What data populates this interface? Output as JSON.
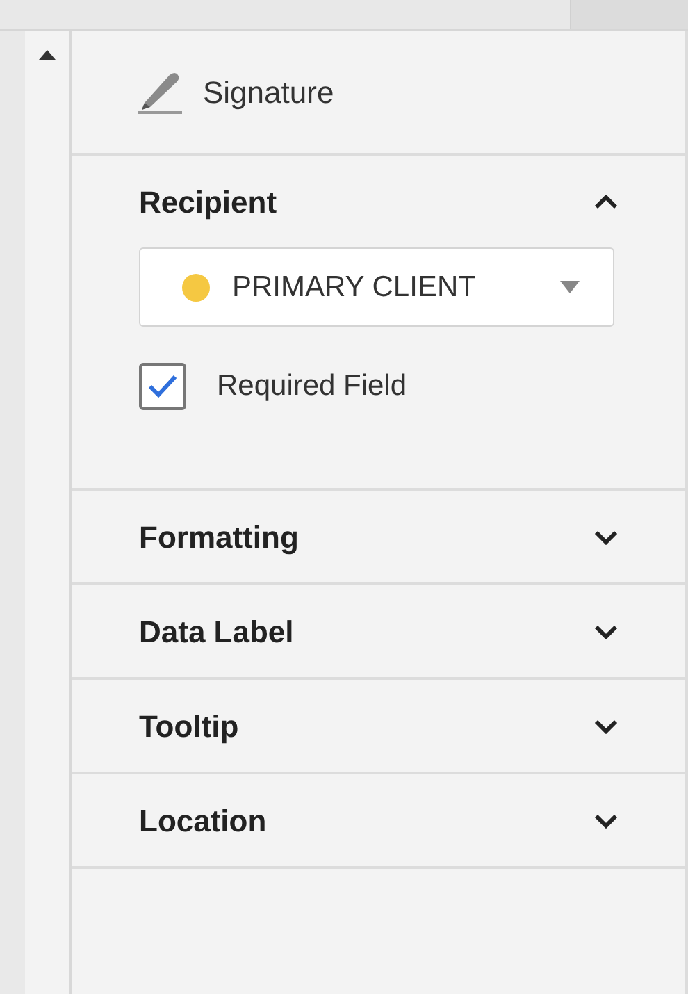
{
  "field_type": {
    "label": "Signature"
  },
  "sections": [
    {
      "title": "Recipient",
      "expanded": true,
      "recipient": {
        "value": "PRIMARY CLIENT",
        "color": "#f5c842"
      },
      "required_field": {
        "label": "Required Field",
        "checked": true
      }
    },
    {
      "title": "Formatting",
      "expanded": false
    },
    {
      "title": "Data Label",
      "expanded": false
    },
    {
      "title": "Tooltip",
      "expanded": false
    },
    {
      "title": "Location",
      "expanded": false
    }
  ]
}
